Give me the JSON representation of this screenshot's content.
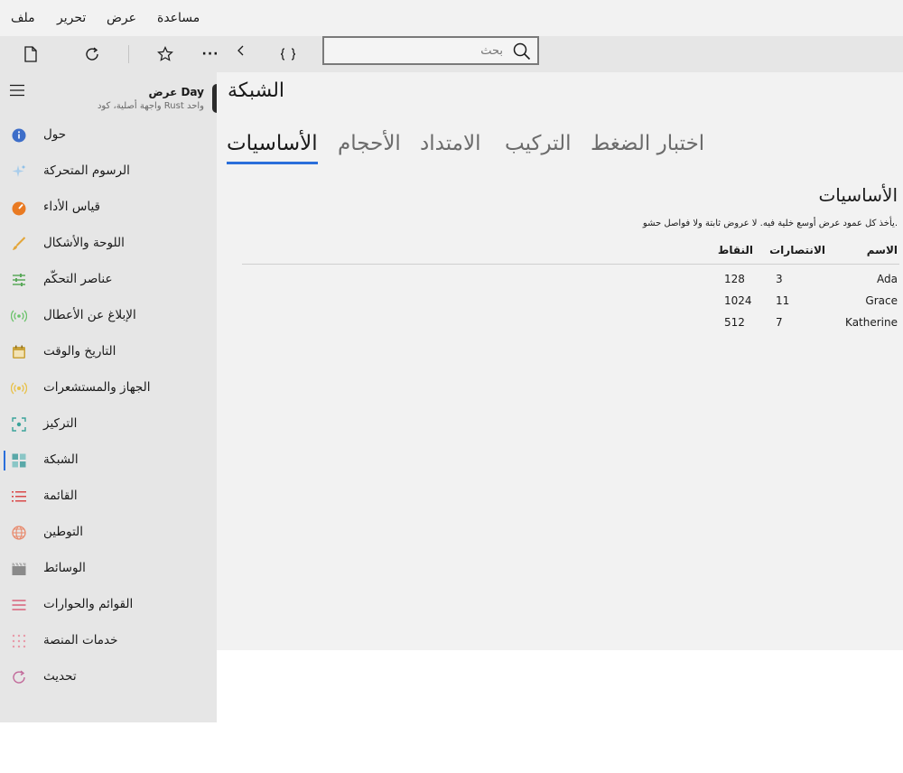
{
  "menu": {
    "file": "ملف",
    "edit": "تحرير",
    "view": "عرض",
    "help": "مساعدة"
  },
  "toolbar": {
    "icons": [
      "new-document-icon",
      "refresh-icon",
      "star-icon",
      "more-icon",
      "chevron-left-icon",
      "braces-icon"
    ],
    "more_label": "···",
    "search_placeholder": "بحث"
  },
  "app": {
    "title": "عرض Day",
    "subtitle": "واجهة أصلية، كود Rust واحد"
  },
  "sidebar": {
    "items": [
      {
        "label": "حول",
        "icon": "info-icon",
        "color": "#3d6ec9"
      },
      {
        "label": "الرسوم المتحركة",
        "icon": "sparkle-icon",
        "color": "#7ab8e8"
      },
      {
        "label": "قياس الأداء",
        "icon": "gauge-icon",
        "color": "#e97a22"
      },
      {
        "label": "اللوحة والأشكال",
        "icon": "brush-icon",
        "color": "#e3a63a"
      },
      {
        "label": "عناصر التحكّم",
        "icon": "sliders-icon",
        "color": "#5aa95a"
      },
      {
        "label": "الإبلاغ عن الأعطال",
        "icon": "broadcast-icon",
        "color": "#6cc36c"
      },
      {
        "label": "التاريخ والوقت",
        "icon": "calendar-icon",
        "color": "#c9a23a"
      },
      {
        "label": "الجهاز والمستشعرات",
        "icon": "sensor-icon",
        "color": "#e8c14a"
      },
      {
        "label": "التركيز",
        "icon": "focus-icon",
        "color": "#3aa39a"
      },
      {
        "label": "الشبكة",
        "icon": "grid-icon",
        "color": "#5aa8a8",
        "selected": true
      },
      {
        "label": "القائمة",
        "icon": "list-icon",
        "color": "#d94a4a"
      },
      {
        "label": "التوطين",
        "icon": "globe-icon",
        "color": "#e8886a"
      },
      {
        "label": "الوسائط",
        "icon": "clapper-icon",
        "color": "#8a8a8a"
      },
      {
        "label": "القوائم والحوارات",
        "icon": "menu-lines-icon",
        "color": "#d9607a"
      },
      {
        "label": "خدمات المنصة",
        "icon": "dots-grid-icon",
        "color": "#e89aa8"
      },
      {
        "label": "تحديث",
        "icon": "update-icon",
        "color": "#c26a9a"
      }
    ]
  },
  "main": {
    "title": "الشبكة",
    "tabs": [
      "الأساسيات",
      "الأحجام",
      "الامتداد",
      "التركيب",
      "اختبار الضغط"
    ],
    "active_tab": "الأساسيات",
    "section_title": "الأساسيات",
    "section_desc": "يأخذ كل عمود عرض أوسع خلية فيه. لا عروض ثابتة ولا فواصل حشو.",
    "table": {
      "headers": [
        "الاسم",
        "الانتصارات",
        "النقاط"
      ],
      "rows": [
        [
          "Ada",
          "3",
          "128"
        ],
        [
          "Grace",
          "11",
          "1024"
        ],
        [
          "Katherine",
          "7",
          "512"
        ]
      ]
    }
  },
  "colors": {
    "accent": "#2a6fdb"
  }
}
